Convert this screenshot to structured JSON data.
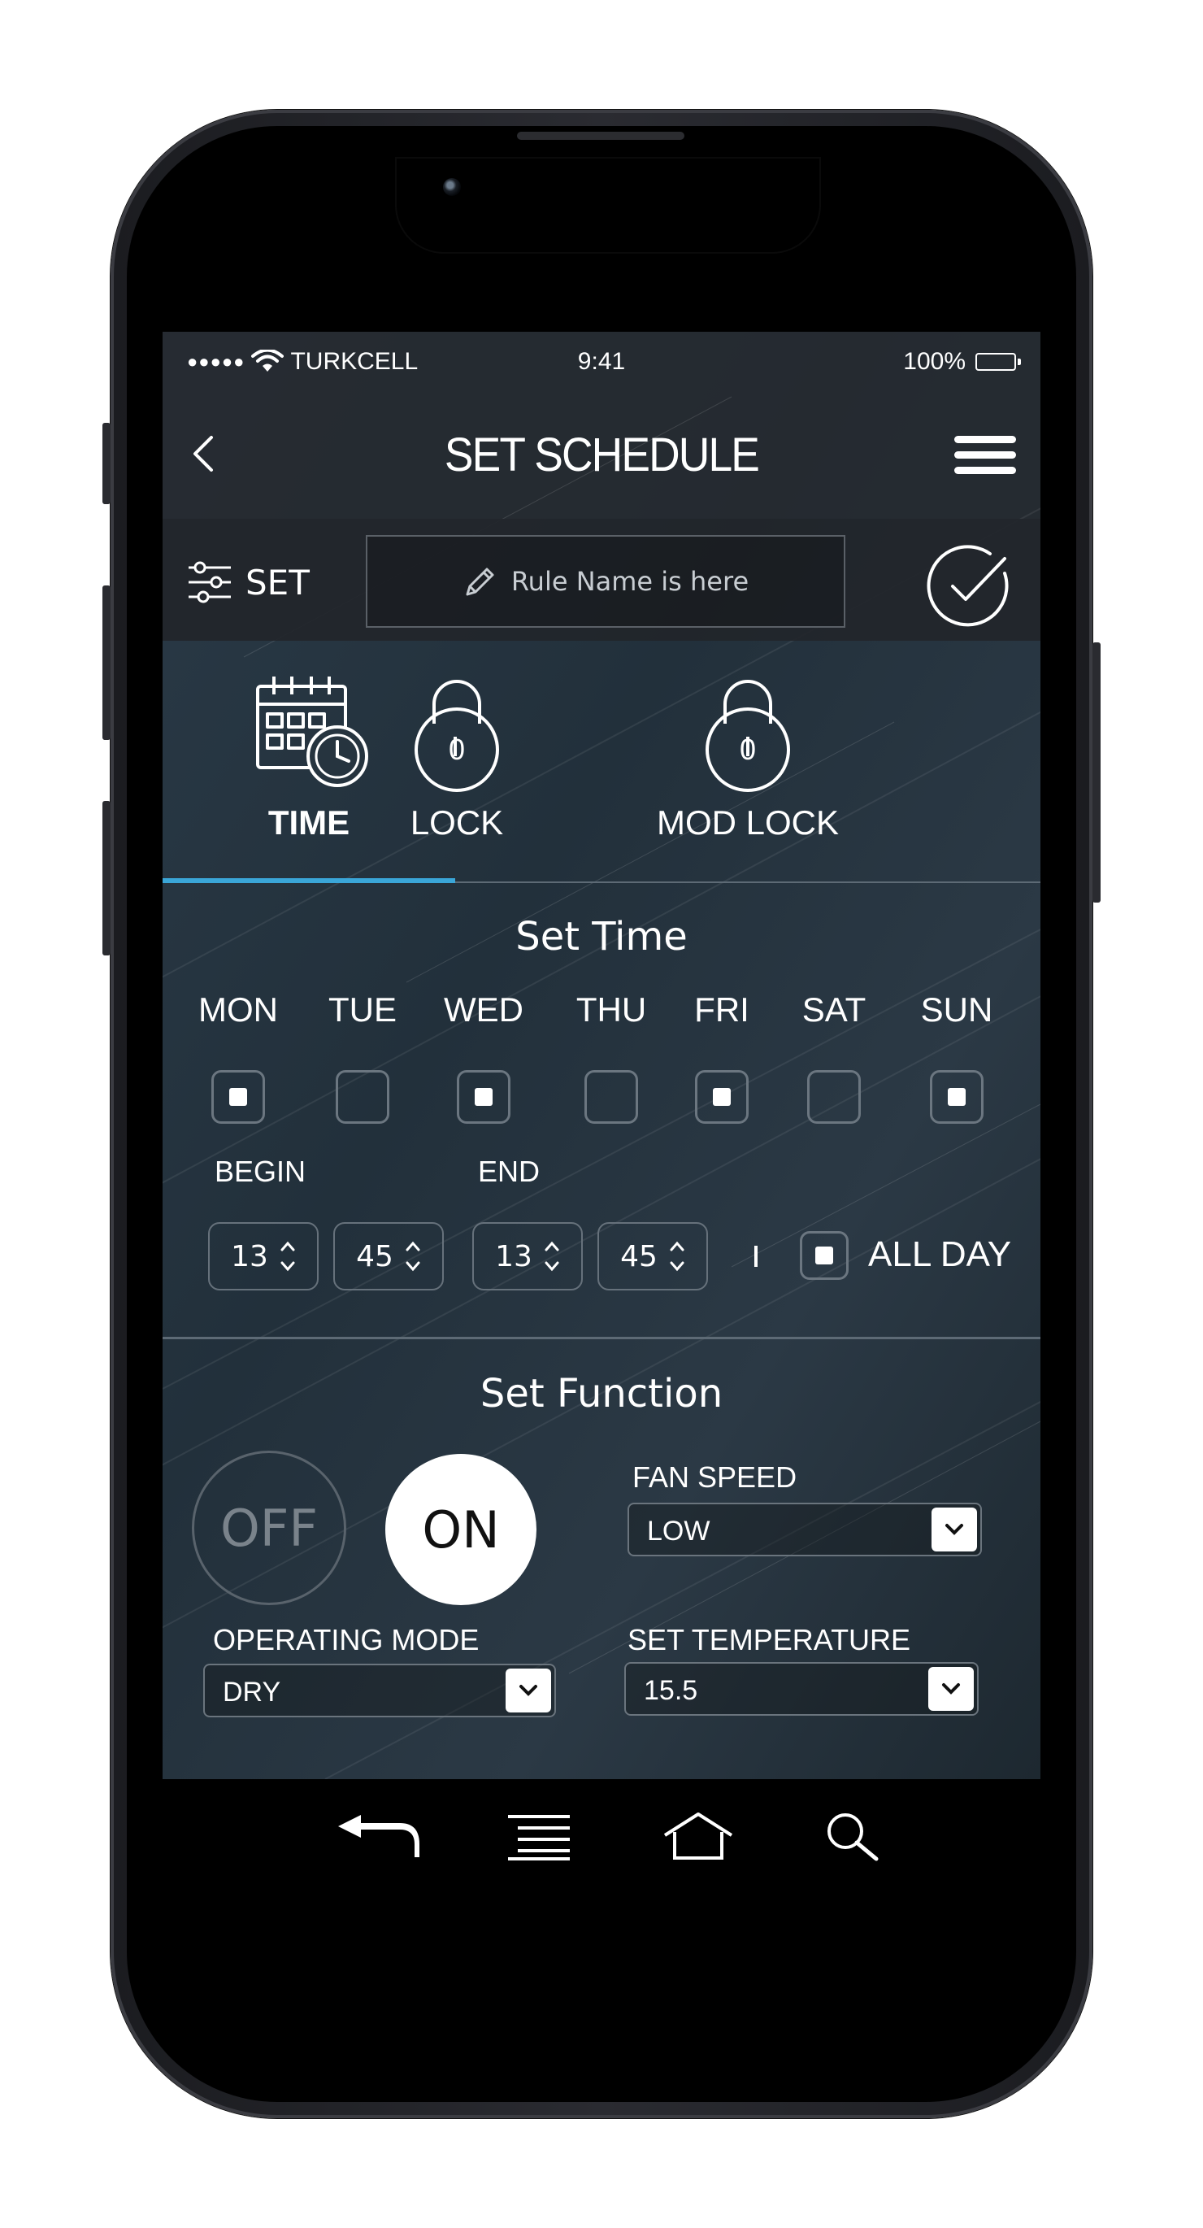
{
  "status_bar": {
    "signal": "●●●●●",
    "carrier": "TURKCELL",
    "time": "9:41",
    "battery": "100%"
  },
  "header": {
    "title": "SET SCHEDULE"
  },
  "rule_bar": {
    "set_label": "SET",
    "rule_name_placeholder": "Rule Name is here"
  },
  "tabs": [
    {
      "label": "TIME",
      "active": true
    },
    {
      "label": "LOCK",
      "badge": "0"
    },
    {
      "label": "MOD LOCK",
      "badge": "0"
    }
  ],
  "set_time": {
    "title": "Set Time",
    "days": [
      {
        "label": "MON",
        "checked": true
      },
      {
        "label": "TUE",
        "checked": false
      },
      {
        "label": "WED",
        "checked": true
      },
      {
        "label": "THU",
        "checked": false
      },
      {
        "label": "FRI",
        "checked": true
      },
      {
        "label": "SAT",
        "checked": false
      },
      {
        "label": "SUN",
        "checked": true
      }
    ],
    "begin_label": "BEGIN",
    "end_label": "END",
    "begin_hour": "13",
    "begin_minute": "45",
    "end_hour": "13",
    "end_minute": "45",
    "all_day_label": "ALL DAY",
    "all_day_checked": true
  },
  "set_function": {
    "title": "Set Function",
    "off_label": "OFF",
    "on_label": "ON",
    "power_state": "on",
    "fan_speed_label": "FAN SPEED",
    "fan_speed_value": "LOW",
    "operating_mode_label": "OPERATING MODE",
    "operating_mode_value": "DRY",
    "set_temperature_label": "SET TEMPERATURE",
    "set_temperature_value": "15.5"
  },
  "icons": {
    "back": "chevron-left-icon",
    "menu": "hamburger-menu-icon",
    "settings": "sliders-icon",
    "edit": "pencil-icon",
    "confirm": "checkmark-circle-icon",
    "time_tab": "calendar-clock-icon",
    "lock_tab": "padlock-icon",
    "nav": [
      "back-arrow-icon",
      "list-icon",
      "home-icon",
      "search-icon"
    ]
  },
  "colors": {
    "accent": "#3aa6d8",
    "screen_bg": "#1e252c",
    "text": "#ffffff"
  }
}
